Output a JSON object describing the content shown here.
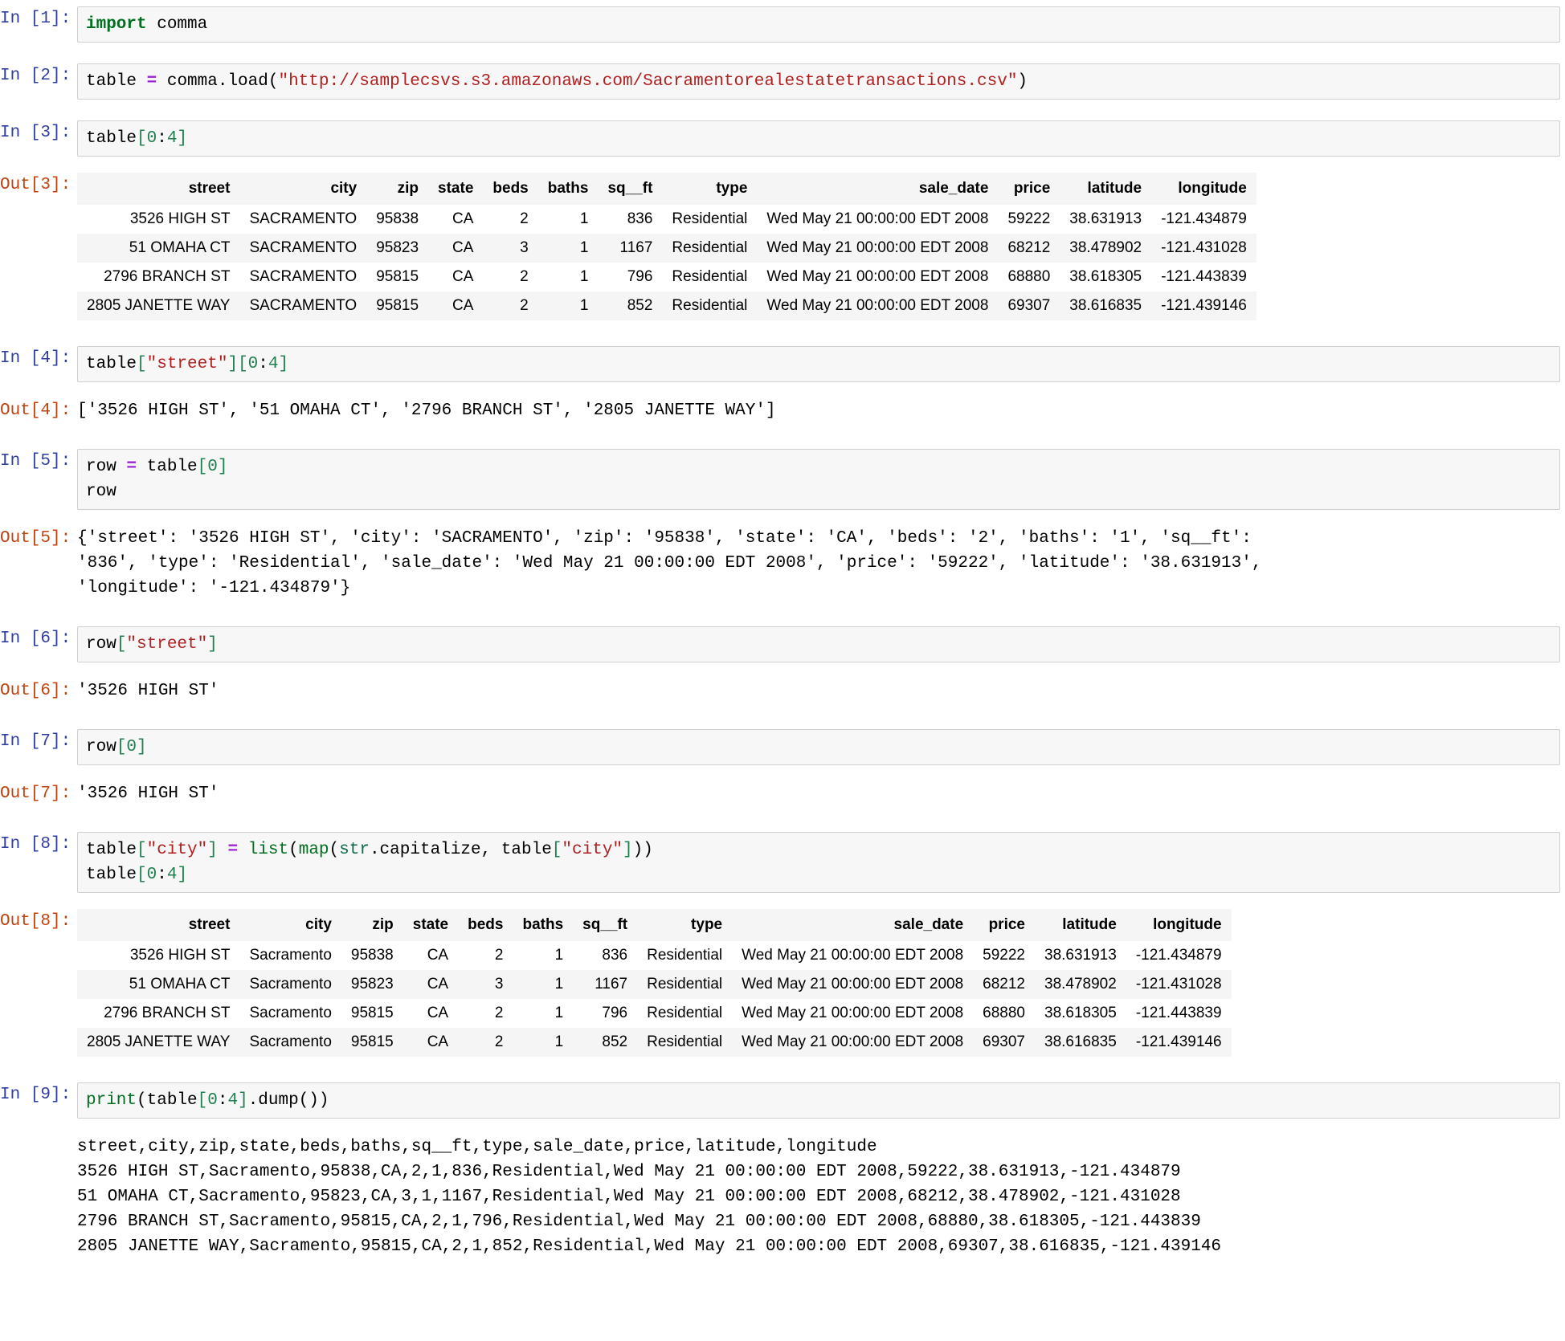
{
  "colors": {
    "in_prompt": "#303F9F",
    "out_prompt": "#C1440E",
    "code_bg": "#f7f7f7",
    "code_border": "#cfcfcf",
    "string": "#B02020",
    "keyword": "#007020",
    "number": "#208050",
    "operator": "#9E24D4",
    "table_header_bg": "#f5f5f5",
    "table_alt_row_bg": "#f5f5f5"
  },
  "cells": [
    {
      "in_prompt": "In [1]:",
      "code_tokens": [
        [
          {
            "t": "import",
            "c": "kw"
          },
          {
            "t": " comma",
            "c": "plain"
          }
        ]
      ]
    },
    {
      "in_prompt": "In [2]:",
      "code_tokens": [
        [
          {
            "t": "table ",
            "c": "plain"
          },
          {
            "t": "=",
            "c": "op"
          },
          {
            "t": " comma.load(",
            "c": "plain"
          },
          {
            "t": "\"http://samplecsvs.s3.amazonaws.com/Sacramentorealestatetransactions.csv\"",
            "c": "str"
          },
          {
            "t": ")",
            "c": "plain"
          }
        ]
      ]
    },
    {
      "in_prompt": "In [3]:",
      "code_tokens": [
        [
          {
            "t": "table",
            "c": "plain"
          },
          {
            "t": "[",
            "c": "bracket"
          },
          {
            "t": "0",
            "c": "num"
          },
          {
            "t": ":",
            "c": "plain"
          },
          {
            "t": "4",
            "c": "num"
          },
          {
            "t": "]",
            "c": "bracket"
          }
        ]
      ],
      "out_prompt": "Out[3]:",
      "out_type": "table",
      "table": {
        "columns": [
          "street",
          "city",
          "zip",
          "state",
          "beds",
          "baths",
          "sq__ft",
          "type",
          "sale_date",
          "price",
          "latitude",
          "longitude"
        ],
        "rows": [
          [
            "3526 HIGH ST",
            "SACRAMENTO",
            "95838",
            "CA",
            "2",
            "1",
            "836",
            "Residential",
            "Wed May 21 00:00:00 EDT 2008",
            "59222",
            "38.631913",
            "-121.434879"
          ],
          [
            "51 OMAHA CT",
            "SACRAMENTO",
            "95823",
            "CA",
            "3",
            "1",
            "1167",
            "Residential",
            "Wed May 21 00:00:00 EDT 2008",
            "68212",
            "38.478902",
            "-121.431028"
          ],
          [
            "2796 BRANCH ST",
            "SACRAMENTO",
            "95815",
            "CA",
            "2",
            "1",
            "796",
            "Residential",
            "Wed May 21 00:00:00 EDT 2008",
            "68880",
            "38.618305",
            "-121.443839"
          ],
          [
            "2805 JANETTE WAY",
            "SACRAMENTO",
            "95815",
            "CA",
            "2",
            "1",
            "852",
            "Residential",
            "Wed May 21 00:00:00 EDT 2008",
            "69307",
            "38.616835",
            "-121.439146"
          ]
        ]
      }
    },
    {
      "in_prompt": "In [4]:",
      "code_tokens": [
        [
          {
            "t": "table",
            "c": "plain"
          },
          {
            "t": "[",
            "c": "bracket"
          },
          {
            "t": "\"street\"",
            "c": "str"
          },
          {
            "t": "]",
            "c": "bracket"
          },
          {
            "t": "[",
            "c": "bracket"
          },
          {
            "t": "0",
            "c": "num"
          },
          {
            "t": ":",
            "c": "plain"
          },
          {
            "t": "4",
            "c": "num"
          },
          {
            "t": "]",
            "c": "bracket"
          }
        ]
      ],
      "out_prompt": "Out[4]:",
      "out_type": "text",
      "text": "['3526 HIGH ST', '51 OMAHA CT', '2796 BRANCH ST', '2805 JANETTE WAY']"
    },
    {
      "in_prompt": "In [5]:",
      "code_tokens": [
        [
          {
            "t": "row ",
            "c": "plain"
          },
          {
            "t": "=",
            "c": "op"
          },
          {
            "t": " table",
            "c": "plain"
          },
          {
            "t": "[",
            "c": "bracket"
          },
          {
            "t": "0",
            "c": "num"
          },
          {
            "t": "]",
            "c": "bracket"
          }
        ],
        [
          {
            "t": "row",
            "c": "plain"
          }
        ]
      ],
      "out_prompt": "Out[5]:",
      "out_type": "text",
      "text": "{'street': '3526 HIGH ST', 'city': 'SACRAMENTO', 'zip': '95838', 'state': 'CA', 'beds': '2', 'baths': '1', 'sq__ft':\n'836', 'type': 'Residential', 'sale_date': 'Wed May 21 00:00:00 EDT 2008', 'price': '59222', 'latitude': '38.631913',\n'longitude': '-121.434879'}"
    },
    {
      "in_prompt": "In [6]:",
      "code_tokens": [
        [
          {
            "t": "row",
            "c": "plain"
          },
          {
            "t": "[",
            "c": "bracket"
          },
          {
            "t": "\"street\"",
            "c": "str"
          },
          {
            "t": "]",
            "c": "bracket"
          }
        ]
      ],
      "out_prompt": "Out[6]:",
      "out_type": "text",
      "text": "'3526 HIGH ST'"
    },
    {
      "in_prompt": "In [7]:",
      "code_tokens": [
        [
          {
            "t": "row",
            "c": "plain"
          },
          {
            "t": "[",
            "c": "bracket"
          },
          {
            "t": "0",
            "c": "num"
          },
          {
            "t": "]",
            "c": "bracket"
          }
        ]
      ],
      "out_prompt": "Out[7]:",
      "out_type": "text",
      "text": "'3526 HIGH ST'"
    },
    {
      "in_prompt": "In [8]:",
      "code_tokens": [
        [
          {
            "t": "table",
            "c": "plain"
          },
          {
            "t": "[",
            "c": "bracket"
          },
          {
            "t": "\"city\"",
            "c": "str"
          },
          {
            "t": "]",
            "c": "bracket"
          },
          {
            "t": " ",
            "c": "plain"
          },
          {
            "t": "=",
            "c": "op"
          },
          {
            "t": " ",
            "c": "plain"
          },
          {
            "t": "list",
            "c": "builtin"
          },
          {
            "t": "(",
            "c": "plain"
          },
          {
            "t": "map",
            "c": "builtin"
          },
          {
            "t": "(",
            "c": "plain"
          },
          {
            "t": "str",
            "c": "type"
          },
          {
            "t": ".capitalize, table",
            "c": "plain"
          },
          {
            "t": "[",
            "c": "bracket"
          },
          {
            "t": "\"city\"",
            "c": "str"
          },
          {
            "t": "]",
            "c": "bracket"
          },
          {
            "t": "))",
            "c": "plain"
          }
        ],
        [
          {
            "t": "table",
            "c": "plain"
          },
          {
            "t": "[",
            "c": "bracket"
          },
          {
            "t": "0",
            "c": "num"
          },
          {
            "t": ":",
            "c": "plain"
          },
          {
            "t": "4",
            "c": "num"
          },
          {
            "t": "]",
            "c": "bracket"
          }
        ]
      ],
      "out_prompt": "Out[8]:",
      "out_type": "table",
      "table": {
        "columns": [
          "street",
          "city",
          "zip",
          "state",
          "beds",
          "baths",
          "sq__ft",
          "type",
          "sale_date",
          "price",
          "latitude",
          "longitude"
        ],
        "rows": [
          [
            "3526 HIGH ST",
            "Sacramento",
            "95838",
            "CA",
            "2",
            "1",
            "836",
            "Residential",
            "Wed May 21 00:00:00 EDT 2008",
            "59222",
            "38.631913",
            "-121.434879"
          ],
          [
            "51 OMAHA CT",
            "Sacramento",
            "95823",
            "CA",
            "3",
            "1",
            "1167",
            "Residential",
            "Wed May 21 00:00:00 EDT 2008",
            "68212",
            "38.478902",
            "-121.431028"
          ],
          [
            "2796 BRANCH ST",
            "Sacramento",
            "95815",
            "CA",
            "2",
            "1",
            "796",
            "Residential",
            "Wed May 21 00:00:00 EDT 2008",
            "68880",
            "38.618305",
            "-121.443839"
          ],
          [
            "2805 JANETTE WAY",
            "Sacramento",
            "95815",
            "CA",
            "2",
            "1",
            "852",
            "Residential",
            "Wed May 21 00:00:00 EDT 2008",
            "69307",
            "38.616835",
            "-121.439146"
          ]
        ]
      }
    },
    {
      "in_prompt": "In [9]:",
      "code_tokens": [
        [
          {
            "t": "print",
            "c": "builtin"
          },
          {
            "t": "(table",
            "c": "plain"
          },
          {
            "t": "[",
            "c": "bracket"
          },
          {
            "t": "0",
            "c": "num"
          },
          {
            "t": ":",
            "c": "plain"
          },
          {
            "t": "4",
            "c": "num"
          },
          {
            "t": "]",
            "c": "bracket"
          },
          {
            "t": ".dump())",
            "c": "plain"
          }
        ]
      ],
      "out_type": "stdout",
      "text": "street,city,zip,state,beds,baths,sq__ft,type,sale_date,price,latitude,longitude\n3526 HIGH ST,Sacramento,95838,CA,2,1,836,Residential,Wed May 21 00:00:00 EDT 2008,59222,38.631913,-121.434879\n51 OMAHA CT,Sacramento,95823,CA,3,1,1167,Residential,Wed May 21 00:00:00 EDT 2008,68212,38.478902,-121.431028\n2796 BRANCH ST,Sacramento,95815,CA,2,1,796,Residential,Wed May 21 00:00:00 EDT 2008,68880,38.618305,-121.443839\n2805 JANETTE WAY,Sacramento,95815,CA,2,1,852,Residential,Wed May 21 00:00:00 EDT 2008,69307,38.616835,-121.439146"
    }
  ]
}
